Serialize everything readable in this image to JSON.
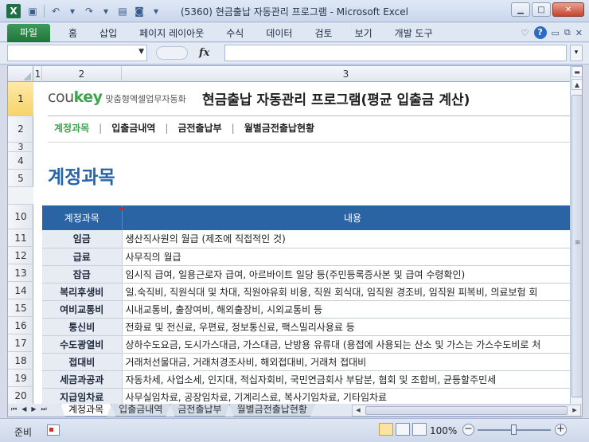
{
  "window": {
    "title": "(5360) 현금출납 자동관리 프로그램 - Microsoft Excel",
    "app_icon": "X"
  },
  "ribbon": {
    "file_tab": "파일",
    "tabs": [
      "홈",
      "삽입",
      "페이지 레이아웃",
      "수식",
      "데이터",
      "검토",
      "보기",
      "개발 도구"
    ]
  },
  "formula_bar": {
    "fx_label": "fx",
    "name_box_value": "",
    "formula_value": ""
  },
  "columns": [
    "1",
    "2",
    "3"
  ],
  "rows": [
    "1",
    "2",
    "3",
    "4",
    "5",
    "10",
    "11",
    "12",
    "13",
    "14",
    "15",
    "16",
    "17",
    "18",
    "19",
    "20"
  ],
  "header": {
    "brand_main": "cou",
    "brand_accent": "key",
    "brand_tagline": "맞춤형엑셀업무자동화",
    "app_title": "현금출납 자동관리 프로그램(평균 입출금 계산)"
  },
  "nav": {
    "items": [
      "계정과목",
      "입출금내역",
      "금전출납부",
      "월별금전출납현황"
    ],
    "separator": "|"
  },
  "section_title": "계정과목",
  "table": {
    "headers": [
      "계정과목",
      "내용"
    ],
    "rows": [
      {
        "name": "임금",
        "desc": "생산직사원의 월급 (제조에 직접적인 것)"
      },
      {
        "name": "급료",
        "desc": "사무직의 월급"
      },
      {
        "name": "잡급",
        "desc": "임시직 급여, 일용근로자 급여, 아르바이트 일당 등(주민등록증사본 및 급여 수령확인)"
      },
      {
        "name": "복리후생비",
        "desc": "일.숙직비, 직원식대 및 차대, 직원야유회 비용, 직원  회식대, 임직원 경조비, 임직원 피복비, 의료보험 회"
      },
      {
        "name": "여비교통비",
        "desc": "시내교통비, 출장여비, 해외출장비, 시외교통비 등"
      },
      {
        "name": "통신비",
        "desc": "전화료 및 전신료, 우편료, 정보통신료, 팩스밀리사용료  등"
      },
      {
        "name": "수도광열비",
        "desc": "상하수도요금, 도시가스대금, 가스대금, 난방용 유류대 (용접에 사용되는 산소 및 가스는 가스수도비로 처"
      },
      {
        "name": "접대비",
        "desc": "거래처선물대금, 거래처경조사비, 해외접대비, 거래처 접대비"
      },
      {
        "name": "세금과공과",
        "desc": "자동차세, 사업소세, 인지대, 적십자회비, 국민연금회사 부담분, 협회 및 조합비, 균등할주민세"
      },
      {
        "name": "지급임차료",
        "desc": "사무실임차료, 공장임차료, 기계리스료, 복사기임차료, 기타임차료"
      }
    ]
  },
  "sheet_tabs": [
    "계정과목",
    "입출금내역",
    "금전출납부",
    "월별금전출납현황"
  ],
  "status": {
    "text": "준비",
    "zoom": "100%",
    "zoom_level_percent": 100
  }
}
